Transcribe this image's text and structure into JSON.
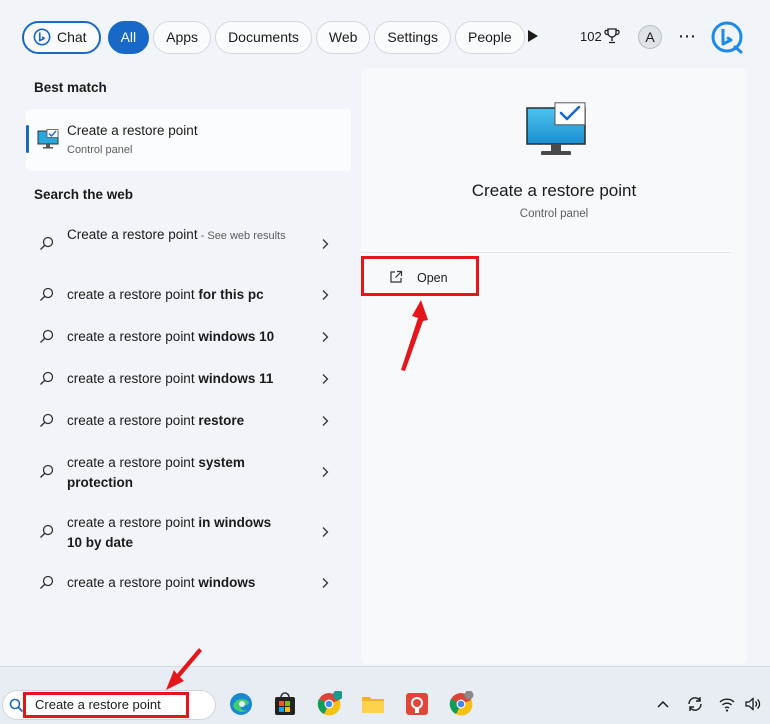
{
  "filters": {
    "chat": "Chat",
    "all": "All",
    "apps": "Apps",
    "documents": "Documents",
    "web": "Web",
    "settings": "Settings",
    "people": "People"
  },
  "header": {
    "rewards_points": "102",
    "avatar_initial": "A",
    "more": "⋯"
  },
  "best_match": {
    "heading": "Best match",
    "title": "Create a restore point",
    "subtitle": "Control panel"
  },
  "search_web": {
    "heading": "Search the web",
    "items": [
      {
        "prefix": "Create a restore point",
        "bold": "",
        "hint": " - See web results"
      },
      {
        "prefix": "create a restore point ",
        "bold": "for this pc",
        "hint": ""
      },
      {
        "prefix": "create a restore point ",
        "bold": "windows 10",
        "hint": ""
      },
      {
        "prefix": "create a restore point ",
        "bold": "windows 11",
        "hint": ""
      },
      {
        "prefix": "create a restore point ",
        "bold": "restore",
        "hint": ""
      },
      {
        "prefix": "create a restore point ",
        "bold": "system protection",
        "hint": ""
      },
      {
        "prefix": "create a restore point ",
        "bold": "in windows 10 by date",
        "hint": ""
      },
      {
        "prefix": "create a restore point ",
        "bold": "windows",
        "hint": ""
      }
    ]
  },
  "preview": {
    "title": "Create a restore point",
    "subtitle": "Control panel",
    "open_label": "Open"
  },
  "taskbar": {
    "search_value": "Create a restore point",
    "apps": [
      "edge-icon",
      "store-icon",
      "chrome-profile-icon",
      "file-explorer-icon",
      "screen-recorder-icon",
      "chrome-icon"
    ]
  },
  "colors": {
    "accent": "#1868c7",
    "highlight": "#e5161a"
  }
}
